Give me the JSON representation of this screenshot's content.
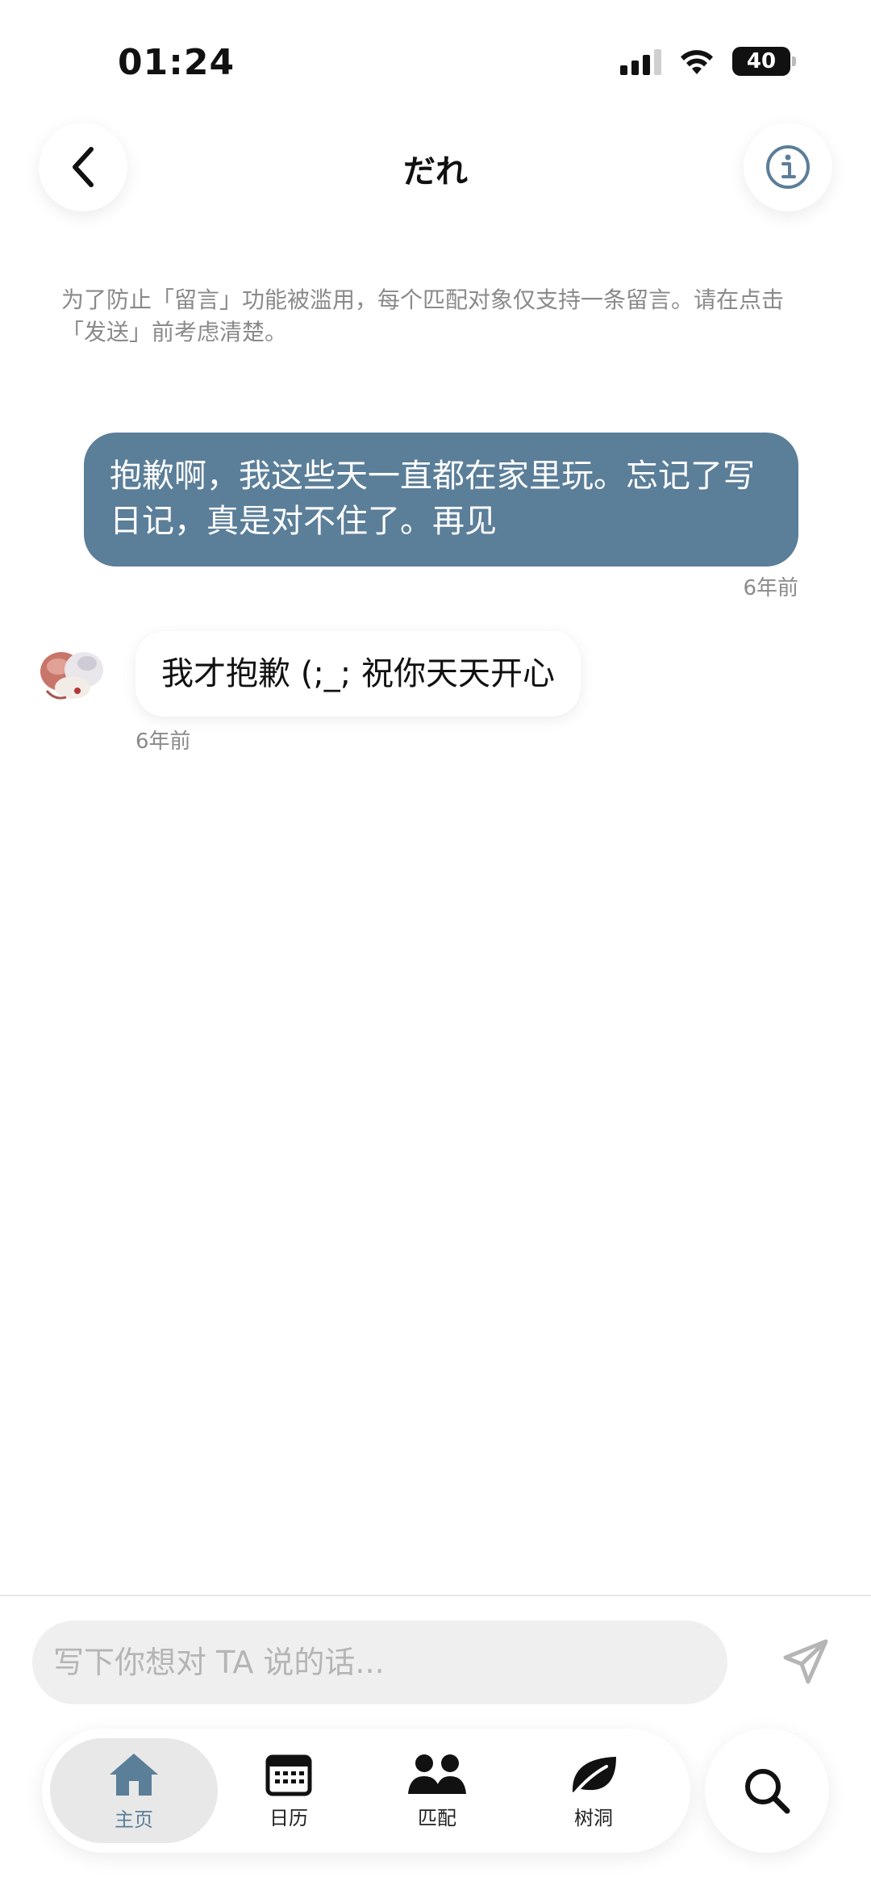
{
  "status_bar": {
    "time": "01:24",
    "battery_level": "40"
  },
  "header": {
    "title": "だれ"
  },
  "notice": "为了防止「留言」功能被滥用，每个匹配对象仅支持一条留言。请在点击「发送」前考虑清楚。",
  "messages": [
    {
      "direction": "outgoing",
      "text": "抱歉啊，我这些天一直都在家里玩。忘记了写日记，真是对不住了。再见",
      "time": "6年前"
    },
    {
      "direction": "incoming",
      "text": "我才抱歉 (;_; 祝你天天开心",
      "time": "6年前"
    }
  ],
  "composer": {
    "placeholder": "写下你想对 TA 说的话..."
  },
  "tabs": [
    {
      "label": "主页",
      "icon": "home-icon",
      "active": true
    },
    {
      "label": "日历",
      "icon": "calendar-icon",
      "active": false
    },
    {
      "label": "匹配",
      "icon": "people-icon",
      "active": false
    },
    {
      "label": "树洞",
      "icon": "leaf-icon",
      "active": false
    }
  ],
  "colors": {
    "accent": "#5b7e99",
    "outgoing_bubble": "#5b7e99",
    "muted_text": "#8a8a8a"
  }
}
